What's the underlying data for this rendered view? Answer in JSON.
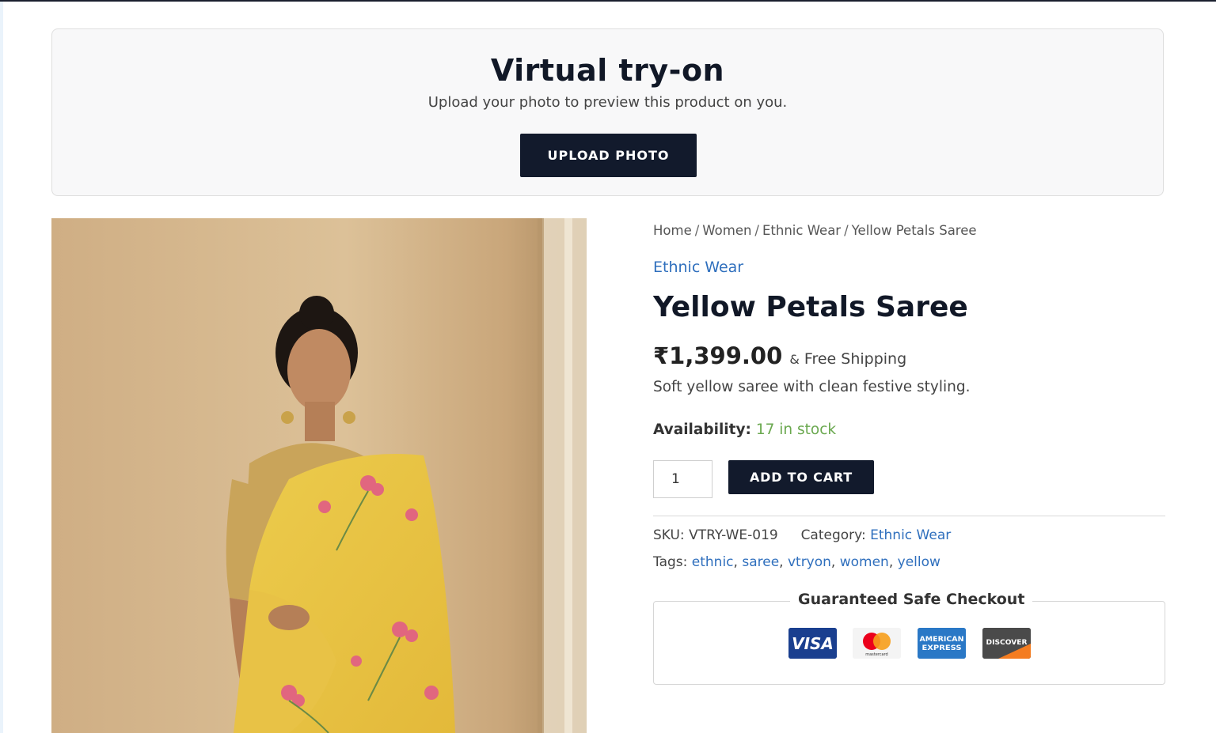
{
  "tryon": {
    "title": "Virtual try-on",
    "subtitle": "Upload your photo to preview this product on you.",
    "button_label": "UPLOAD PHOTO"
  },
  "product_image": {
    "alt": "Woman wearing a yellow saree with pink floral print"
  },
  "breadcrumb": {
    "items": [
      "Home",
      "Women",
      "Ethnic Wear",
      "Yellow Petals Saree"
    ],
    "separator": "/"
  },
  "product": {
    "category": "Ethnic Wear",
    "title": "Yellow Petals Saree",
    "price": "₹1,399.00",
    "shipping_amp": "&",
    "shipping": "Free Shipping",
    "description": "Soft yellow saree with clean festive styling.",
    "availability_label": "Availability:",
    "availability_value": "17 in stock",
    "quantity": "1",
    "add_to_cart_label": "ADD TO CART"
  },
  "meta": {
    "sku_label": "SKU:",
    "sku_value": "VTRY-WE-019",
    "category_label": "Category:",
    "category_value": "Ethnic Wear",
    "tags_label": "Tags:",
    "tags": [
      "ethnic",
      "saree",
      "vtryon",
      "women",
      "yellow"
    ]
  },
  "checkout": {
    "title": "Guaranteed Safe Checkout",
    "cards": [
      {
        "name": "visa",
        "label": "VISA"
      },
      {
        "name": "mastercard",
        "label": "mastercard"
      },
      {
        "name": "amex",
        "label": "AMERICAN EXPRESS"
      },
      {
        "name": "discover",
        "label": "DISCOVER"
      }
    ]
  },
  "colors": {
    "primary_button": "#121a2c",
    "link": "#2f6fbd",
    "in_stock": "#6aa84f"
  }
}
